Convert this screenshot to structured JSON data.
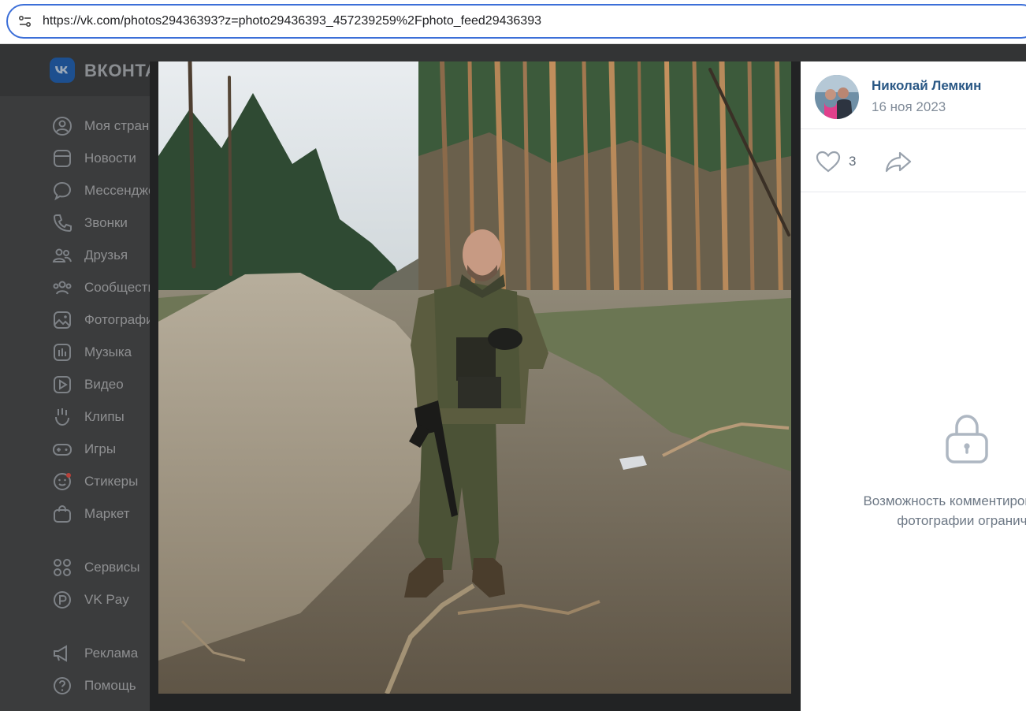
{
  "browser": {
    "url": "https://vk.com/photos29436393?z=photo29436393_457239259%2Fphoto_feed29436393"
  },
  "header": {
    "logo_text": "ВКОНТАКТЕ"
  },
  "sidebar": {
    "items": [
      {
        "label": "Моя страница",
        "icon": "user-icon"
      },
      {
        "label": "Новости",
        "icon": "news-icon"
      },
      {
        "label": "Мессенджер",
        "icon": "message-icon"
      },
      {
        "label": "Звонки",
        "icon": "phone-icon"
      },
      {
        "label": "Друзья",
        "icon": "friends-icon"
      },
      {
        "label": "Сообщества",
        "icon": "groups-icon"
      },
      {
        "label": "Фотографии",
        "icon": "photo-icon"
      },
      {
        "label": "Музыка",
        "icon": "music-icon"
      },
      {
        "label": "Видео",
        "icon": "video-icon"
      },
      {
        "label": "Клипы",
        "icon": "clips-icon"
      },
      {
        "label": "Игры",
        "icon": "gamepad-icon"
      },
      {
        "label": "Стикеры",
        "icon": "sticker-icon"
      },
      {
        "label": "Маркет",
        "icon": "market-icon"
      },
      {
        "label": "Сервисы",
        "icon": "services-icon"
      },
      {
        "label": "VK Pay",
        "icon": "vkpay-icon"
      },
      {
        "label": "Реклама",
        "icon": "megaphone-icon"
      },
      {
        "label": "Помощь",
        "icon": "help-icon"
      }
    ]
  },
  "photo_viewer": {
    "author": "Николай Лемкин",
    "date": "16 ноя 2023",
    "likes": "3",
    "comments_locked_line1": "Возможность комментировать этой",
    "comments_locked_line2": "фотографии ограничена"
  },
  "colors": {
    "accent": "#2a5885",
    "muted": "#818c99",
    "address_border": "#3c6fd8"
  }
}
